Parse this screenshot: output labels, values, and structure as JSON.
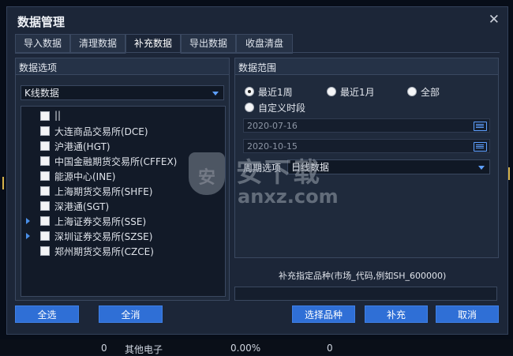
{
  "window": {
    "title": "数据管理",
    "close_glyph": "✕"
  },
  "tabs": [
    {
      "label": "导入数据"
    },
    {
      "label": "清理数据"
    },
    {
      "label": "补充数据"
    },
    {
      "label": "导出数据"
    },
    {
      "label": "收盘清盘"
    }
  ],
  "active_tab": "补充数据",
  "options_panel": {
    "title": "数据选项",
    "data_type": "K线数据",
    "items": [
      {
        "label": "||",
        "expandable": false
      },
      {
        "label": "大连商品交易所(DCE)",
        "expandable": false
      },
      {
        "label": "沪港通(HGT)",
        "expandable": false
      },
      {
        "label": "中国金融期货交易所(CFFEX)",
        "expandable": false
      },
      {
        "label": "能源中心(INE)",
        "expandable": false
      },
      {
        "label": "上海期货交易所(SHFE)",
        "expandable": false
      },
      {
        "label": "深港通(SGT)",
        "expandable": false
      },
      {
        "label": "上海证券交易所(SSE)",
        "expandable": true
      },
      {
        "label": "深圳证券交易所(SZSE)",
        "expandable": true
      },
      {
        "label": "郑州期货交易所(CZCE)",
        "expandable": false
      }
    ]
  },
  "range_panel": {
    "title": "数据范围",
    "radios": [
      {
        "label": "最近1周",
        "selected": true
      },
      {
        "label": "最近1月",
        "selected": false
      },
      {
        "label": "全部",
        "selected": false
      },
      {
        "label": "自定义时段",
        "selected": false
      }
    ],
    "start_date": "2020-07-16",
    "end_date": "2020-10-15",
    "period_label": "周期选项",
    "period_value": "日线数据"
  },
  "supplement": {
    "hint": "补充指定品种(市场_代码,例如SH_600000)",
    "value": ""
  },
  "buttons": {
    "select_all": "全选",
    "deselect_all": "全消",
    "choose": "选择品种",
    "supplement": "补充",
    "cancel": "取消"
  },
  "background": {
    "row_a": "0",
    "row_b": "其他电子",
    "row_c": "0.00%",
    "row_d": "0"
  },
  "watermark": {
    "text": "安下载",
    "sub": "anxz.com",
    "shield": "安"
  },
  "colors": {
    "accent": "#2f6fd6",
    "dialog_bg": "#1c2638",
    "panel_bg": "#1f2a3c"
  }
}
